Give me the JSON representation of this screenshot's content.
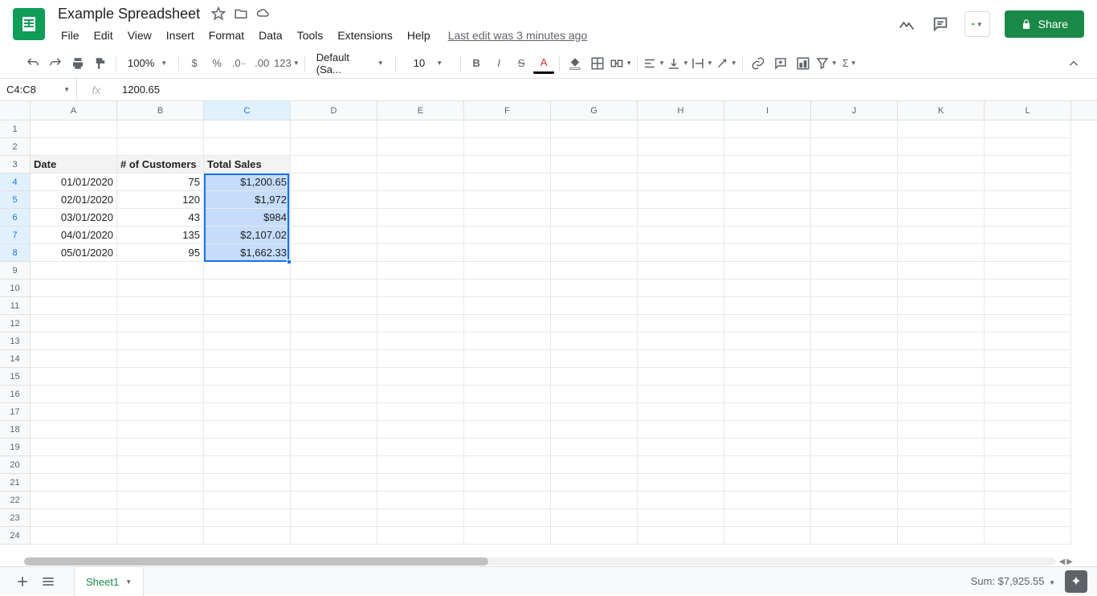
{
  "doc": {
    "title": "Example Spreadsheet",
    "last_edit": "Last edit was 3 minutes ago"
  },
  "menus": [
    "File",
    "Edit",
    "View",
    "Insert",
    "Format",
    "Data",
    "Tools",
    "Extensions",
    "Help"
  ],
  "toolbar": {
    "zoom": "100%",
    "font": "Default (Sa...",
    "size": "10",
    "fmt123": "123"
  },
  "share": {
    "label": "Share"
  },
  "formula": {
    "name_box": "C4:C8",
    "fx": "fx",
    "value": "1200.65"
  },
  "columns": [
    "A",
    "B",
    "C",
    "D",
    "E",
    "F",
    "G",
    "H",
    "I",
    "J",
    "K",
    "L"
  ],
  "rows": [
    "1",
    "2",
    "3",
    "4",
    "5",
    "6",
    "7",
    "8",
    "9",
    "10",
    "11",
    "12",
    "13",
    "14",
    "15",
    "16",
    "17",
    "18",
    "19",
    "20",
    "21",
    "22",
    "23",
    "24"
  ],
  "table": {
    "headers": {
      "a": "Date",
      "b": "# of Customers",
      "c": "Total Sales"
    },
    "data": [
      {
        "a": "01/01/2020",
        "b": "75",
        "c": "$1,200.65"
      },
      {
        "a": "02/01/2020",
        "b": "120",
        "c": "$1,972"
      },
      {
        "a": "03/01/2020",
        "b": "43",
        "c": "$984"
      },
      {
        "a": "04/01/2020",
        "b": "135",
        "c": "$2,107.02"
      },
      {
        "a": "05/01/2020",
        "b": "95",
        "c": "$1,662.33"
      }
    ]
  },
  "sheet": {
    "name": "Sheet1"
  },
  "status": {
    "sum": "Sum: $7,925.55"
  }
}
